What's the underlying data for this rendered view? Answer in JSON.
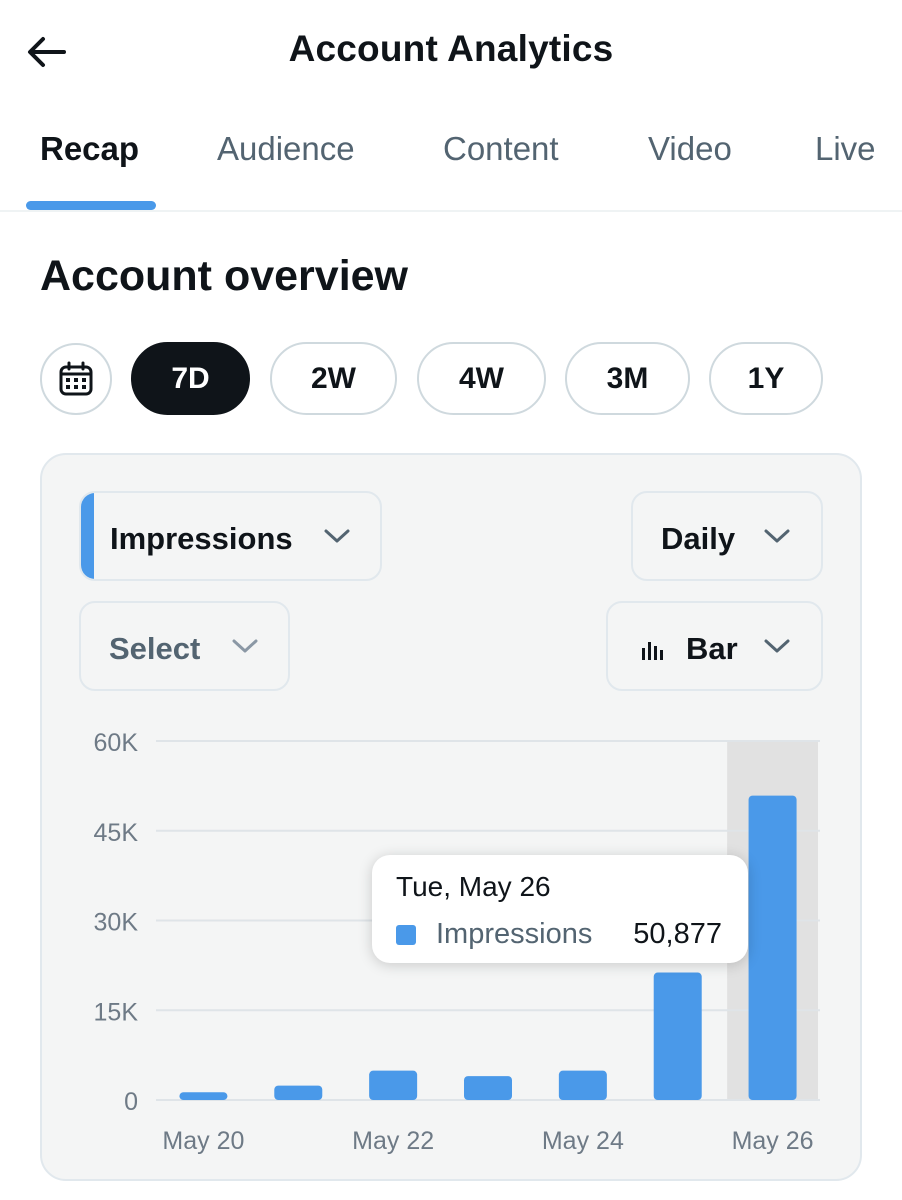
{
  "header": {
    "title": "Account Analytics",
    "back_icon": "arrow-left-icon"
  },
  "tabs": [
    {
      "label": "Recap",
      "active": true
    },
    {
      "label": "Audience",
      "active": false
    },
    {
      "label": "Content",
      "active": false
    },
    {
      "label": "Video",
      "active": false
    },
    {
      "label": "Live",
      "active": false
    }
  ],
  "section_title": "Account overview",
  "ranges": {
    "calendar_icon": "calendar-icon",
    "options": [
      {
        "label": "7D",
        "active": true
      },
      {
        "label": "2W",
        "active": false
      },
      {
        "label": "4W",
        "active": false
      },
      {
        "label": "3M",
        "active": false
      },
      {
        "label": "1Y",
        "active": false
      }
    ]
  },
  "controls": {
    "metric": "Impressions",
    "interval": "Daily",
    "compare": "Select",
    "chart_type": "Bar"
  },
  "colors": {
    "accent": "#4a99e9",
    "dark": "#0f1419",
    "muted": "#536471",
    "highlight": "#e1e1e1"
  },
  "tooltip": {
    "date": "Tue, May 26",
    "series": "Impressions",
    "value": "50,877"
  },
  "chart_data": {
    "type": "bar",
    "categories": [
      "May 20",
      "May 21",
      "May 22",
      "May 23",
      "May 24",
      "May 25",
      "May 26"
    ],
    "x_tick_labels": [
      "May 20",
      "",
      "May 22",
      "",
      "May 24",
      "",
      "May 26"
    ],
    "series": [
      {
        "name": "Impressions",
        "values": [
          1300,
          2400,
          4900,
          4000,
          4900,
          21300,
          50877
        ]
      }
    ],
    "ylim": [
      0,
      60000
    ],
    "y_ticks": [
      0,
      15000,
      30000,
      45000,
      60000
    ],
    "y_tick_labels": [
      "0",
      "15K",
      "30K",
      "45K",
      "60K"
    ],
    "grid": true,
    "highlighted_category": "May 26"
  }
}
